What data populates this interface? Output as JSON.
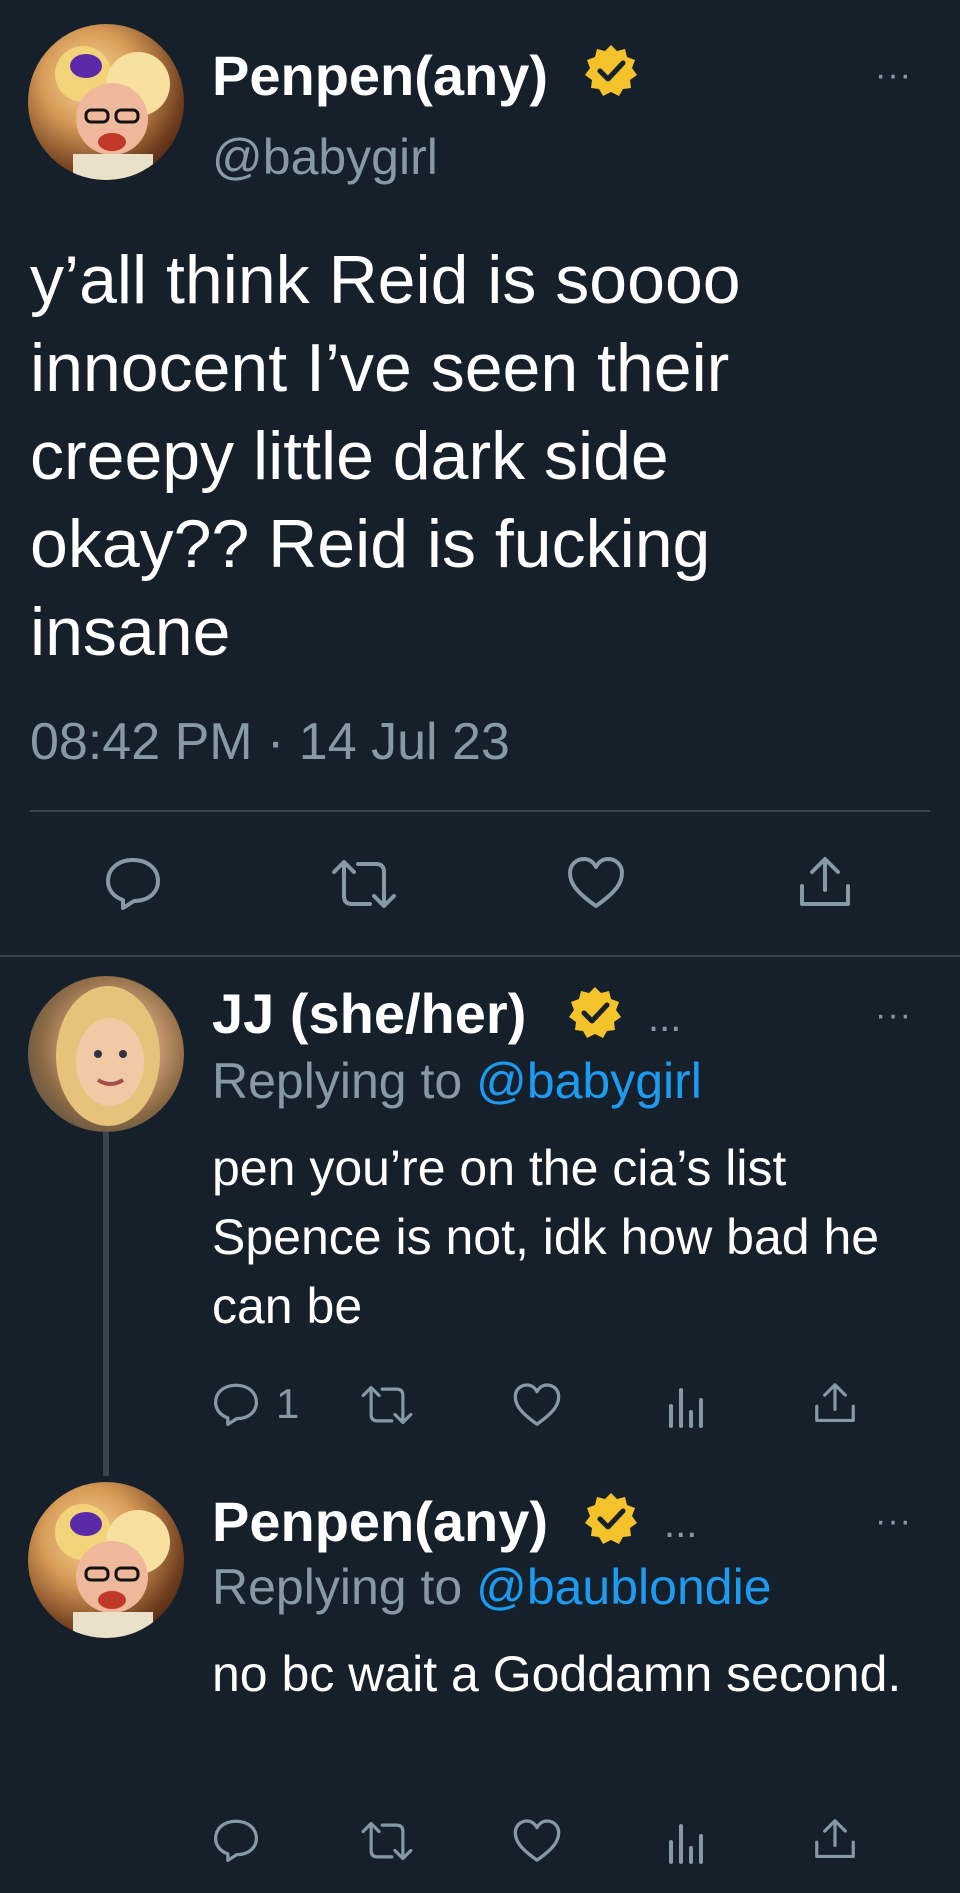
{
  "main_tweet": {
    "author_name": "Penpen(any)",
    "handle": "@babygirl",
    "text": "y’all think Reid is soooo innocent I’ve seen their creepy little dark side okay?? Reid is fucking insane",
    "timestamp": "08:42 PM · 14 Jul 23",
    "more": "···"
  },
  "reply1": {
    "author_name": "JJ (she/her)",
    "dots": "...",
    "replying_prefix": "Replying to",
    "replying_to": "@babygirl",
    "text": "pen you’re on the cia’s list Spence is not, idk how bad he can be",
    "reply_count": "1",
    "more": "···"
  },
  "reply2": {
    "author_name": "Penpen(any)",
    "dots": "...",
    "replying_prefix": "Replying to",
    "replying_to": "@baublondie",
    "text": "no bc wait a Goddamn second.",
    "more": "···"
  },
  "colors": {
    "background": "#15202b",
    "muted": "#8899a6",
    "link": "#1d9bf0",
    "verified": "#f4c22b",
    "divider": "#38444d"
  },
  "icons": [
    "reply-icon",
    "retweet-icon",
    "like-icon",
    "share-icon",
    "analytics-icon",
    "verified-icon",
    "more-icon"
  ]
}
